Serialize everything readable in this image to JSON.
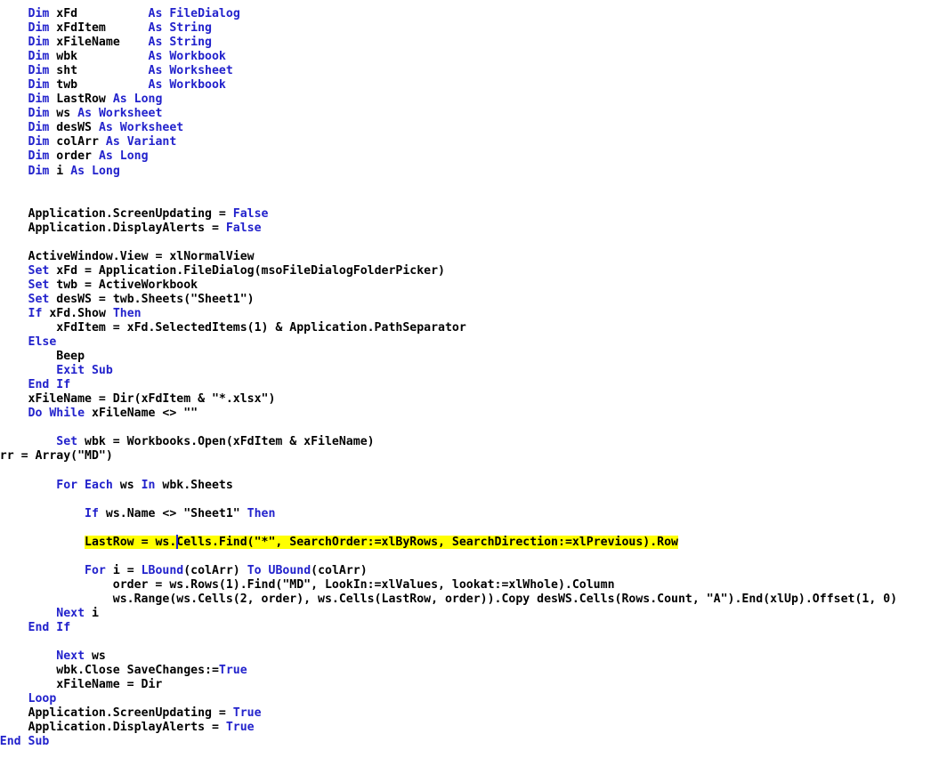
{
  "app": {
    "kind": "vba-code-editor",
    "language": "VBA",
    "colors": {
      "background": "#ffffff",
      "text": "#000000",
      "keyword": "#2222cc",
      "highlight": "#ffff00",
      "caret": "#2222cc"
    }
  },
  "editor": {
    "caret_after_text": "ws.",
    "highlighted_line_index": 37,
    "lines": [
      {
        "indent": 8,
        "tokens": [
          {
            "t": "kw",
            "v": "Dim"
          },
          {
            "t": "txt",
            "v": " xFd          "
          },
          {
            "t": "kw",
            "v": "As"
          },
          {
            "t": "txt",
            "v": " "
          },
          {
            "t": "kw",
            "v": "FileDialog"
          }
        ]
      },
      {
        "indent": 8,
        "tokens": [
          {
            "t": "kw",
            "v": "Dim"
          },
          {
            "t": "txt",
            "v": " xFdItem      "
          },
          {
            "t": "kw",
            "v": "As"
          },
          {
            "t": "txt",
            "v": " "
          },
          {
            "t": "kw",
            "v": "String"
          }
        ]
      },
      {
        "indent": 8,
        "tokens": [
          {
            "t": "kw",
            "v": "Dim"
          },
          {
            "t": "txt",
            "v": " xFileName    "
          },
          {
            "t": "kw",
            "v": "As"
          },
          {
            "t": "txt",
            "v": " "
          },
          {
            "t": "kw",
            "v": "String"
          }
        ]
      },
      {
        "indent": 8,
        "tokens": [
          {
            "t": "kw",
            "v": "Dim"
          },
          {
            "t": "txt",
            "v": " wbk          "
          },
          {
            "t": "kw",
            "v": "As"
          },
          {
            "t": "txt",
            "v": " "
          },
          {
            "t": "kw",
            "v": "Workbook"
          }
        ]
      },
      {
        "indent": 8,
        "tokens": [
          {
            "t": "kw",
            "v": "Dim"
          },
          {
            "t": "txt",
            "v": " sht          "
          },
          {
            "t": "kw",
            "v": "As"
          },
          {
            "t": "txt",
            "v": " "
          },
          {
            "t": "kw",
            "v": "Worksheet"
          }
        ]
      },
      {
        "indent": 8,
        "tokens": [
          {
            "t": "kw",
            "v": "Dim"
          },
          {
            "t": "txt",
            "v": " twb          "
          },
          {
            "t": "kw",
            "v": "As"
          },
          {
            "t": "txt",
            "v": " "
          },
          {
            "t": "kw",
            "v": "Workbook"
          }
        ]
      },
      {
        "indent": 8,
        "tokens": [
          {
            "t": "kw",
            "v": "Dim"
          },
          {
            "t": "txt",
            "v": " LastRow "
          },
          {
            "t": "kw",
            "v": "As"
          },
          {
            "t": "txt",
            "v": " "
          },
          {
            "t": "kw",
            "v": "Long"
          }
        ]
      },
      {
        "indent": 8,
        "tokens": [
          {
            "t": "kw",
            "v": "Dim"
          },
          {
            "t": "txt",
            "v": " ws "
          },
          {
            "t": "kw",
            "v": "As"
          },
          {
            "t": "txt",
            "v": " "
          },
          {
            "t": "kw",
            "v": "Worksheet"
          }
        ]
      },
      {
        "indent": 8,
        "tokens": [
          {
            "t": "kw",
            "v": "Dim"
          },
          {
            "t": "txt",
            "v": " desWS "
          },
          {
            "t": "kw",
            "v": "As"
          },
          {
            "t": "txt",
            "v": " "
          },
          {
            "t": "kw",
            "v": "Worksheet"
          }
        ]
      },
      {
        "indent": 8,
        "tokens": [
          {
            "t": "kw",
            "v": "Dim"
          },
          {
            "t": "txt",
            "v": " colArr "
          },
          {
            "t": "kw",
            "v": "As"
          },
          {
            "t": "txt",
            "v": " "
          },
          {
            "t": "kw",
            "v": "Variant"
          }
        ]
      },
      {
        "indent": 8,
        "tokens": [
          {
            "t": "kw",
            "v": "Dim"
          },
          {
            "t": "txt",
            "v": " order "
          },
          {
            "t": "kw",
            "v": "As"
          },
          {
            "t": "txt",
            "v": " "
          },
          {
            "t": "kw",
            "v": "Long"
          }
        ]
      },
      {
        "indent": 8,
        "tokens": [
          {
            "t": "kw",
            "v": "Dim"
          },
          {
            "t": "txt",
            "v": " i "
          },
          {
            "t": "kw",
            "v": "As"
          },
          {
            "t": "txt",
            "v": " "
          },
          {
            "t": "kw",
            "v": "Long"
          }
        ]
      },
      {
        "indent": 0,
        "tokens": []
      },
      {
        "indent": 0,
        "tokens": []
      },
      {
        "indent": 8,
        "tokens": [
          {
            "t": "txt",
            "v": "Application.ScreenUpdating = "
          },
          {
            "t": "kw",
            "v": "False"
          }
        ]
      },
      {
        "indent": 8,
        "tokens": [
          {
            "t": "txt",
            "v": "Application.DisplayAlerts = "
          },
          {
            "t": "kw",
            "v": "False"
          }
        ]
      },
      {
        "indent": 0,
        "tokens": []
      },
      {
        "indent": 8,
        "tokens": [
          {
            "t": "txt",
            "v": "ActiveWindow.View = xlNormalView"
          }
        ]
      },
      {
        "indent": 8,
        "tokens": [
          {
            "t": "kw",
            "v": "Set"
          },
          {
            "t": "txt",
            "v": " xFd = Application.FileDialog(msoFileDialogFolderPicker)"
          }
        ]
      },
      {
        "indent": 8,
        "tokens": [
          {
            "t": "kw",
            "v": "Set"
          },
          {
            "t": "txt",
            "v": " twb = ActiveWorkbook"
          }
        ]
      },
      {
        "indent": 8,
        "tokens": [
          {
            "t": "kw",
            "v": "Set"
          },
          {
            "t": "txt",
            "v": " desWS = twb.Sheets(\"Sheet1\")"
          }
        ]
      },
      {
        "indent": 8,
        "tokens": [
          {
            "t": "kw",
            "v": "If"
          },
          {
            "t": "txt",
            "v": " xFd.Show "
          },
          {
            "t": "kw",
            "v": "Then"
          }
        ]
      },
      {
        "indent": 12,
        "tokens": [
          {
            "t": "txt",
            "v": "xFdItem = xFd.SelectedItems(1) & Application.PathSeparator"
          }
        ]
      },
      {
        "indent": 8,
        "tokens": [
          {
            "t": "kw",
            "v": "Else"
          }
        ]
      },
      {
        "indent": 12,
        "tokens": [
          {
            "t": "txt",
            "v": "Beep"
          }
        ]
      },
      {
        "indent": 12,
        "tokens": [
          {
            "t": "kw",
            "v": "Exit Sub"
          }
        ]
      },
      {
        "indent": 8,
        "tokens": [
          {
            "t": "kw",
            "v": "End If"
          }
        ]
      },
      {
        "indent": 8,
        "tokens": [
          {
            "t": "txt",
            "v": "xFileName = Dir(xFdItem & \"*.xlsx\")"
          }
        ]
      },
      {
        "indent": 8,
        "tokens": [
          {
            "t": "kw",
            "v": "Do While"
          },
          {
            "t": "txt",
            "v": " xFileName <> \"\""
          }
        ]
      },
      {
        "indent": 0,
        "tokens": []
      },
      {
        "indent": 12,
        "tokens": [
          {
            "t": "kw",
            "v": "Set"
          },
          {
            "t": "txt",
            "v": " wbk = Workbooks.Open(xFdItem & xFileName)"
          }
        ]
      },
      {
        "indent": 0,
        "tokens": [
          {
            "t": "txt",
            "v": "colArr = Array(\"MD\")"
          }
        ]
      },
      {
        "indent": 0,
        "tokens": []
      },
      {
        "indent": 12,
        "tokens": [
          {
            "t": "kw",
            "v": "For Each"
          },
          {
            "t": "txt",
            "v": " ws "
          },
          {
            "t": "kw",
            "v": "In"
          },
          {
            "t": "txt",
            "v": " wbk.Sheets"
          }
        ]
      },
      {
        "indent": 0,
        "tokens": []
      },
      {
        "indent": 16,
        "tokens": [
          {
            "t": "kw",
            "v": "If"
          },
          {
            "t": "txt",
            "v": " ws.Name <> \"Sheet1\" "
          },
          {
            "t": "kw",
            "v": "Then"
          }
        ]
      },
      {
        "indent": 0,
        "tokens": []
      },
      {
        "indent": 16,
        "highlight": true,
        "tokens": [
          {
            "t": "txt",
            "v": "LastRow = ws."
          },
          {
            "t": "caret",
            "v": ""
          },
          {
            "t": "txt",
            "v": "Cells.Find(\"*\", SearchOrder:=xlByRows, SearchDirection:=xlPrevious).Row"
          }
        ]
      },
      {
        "indent": 0,
        "tokens": []
      },
      {
        "indent": 16,
        "tokens": [
          {
            "t": "kw",
            "v": "For"
          },
          {
            "t": "txt",
            "v": " i = "
          },
          {
            "t": "kw",
            "v": "LBound"
          },
          {
            "t": "txt",
            "v": "(colArr) "
          },
          {
            "t": "kw",
            "v": "To"
          },
          {
            "t": "txt",
            "v": " "
          },
          {
            "t": "kw",
            "v": "UBound"
          },
          {
            "t": "txt",
            "v": "(colArr)"
          }
        ]
      },
      {
        "indent": 20,
        "tokens": [
          {
            "t": "txt",
            "v": "order = ws.Rows(1).Find(\"MD\", LookIn:=xlValues, lookat:=xlWhole).Column"
          }
        ]
      },
      {
        "indent": 20,
        "tokens": [
          {
            "t": "txt",
            "v": "ws.Range(ws.Cells(2, order), ws.Cells(LastRow, order)).Copy desWS.Cells(Rows.Count, \"A\").End(xlUp).Offset(1, 0)"
          }
        ]
      },
      {
        "indent": 12,
        "tokens": [
          {
            "t": "kw",
            "v": "Next"
          },
          {
            "t": "txt",
            "v": " i"
          }
        ]
      },
      {
        "indent": 8,
        "tokens": [
          {
            "t": "kw",
            "v": "End If"
          }
        ]
      },
      {
        "indent": 0,
        "tokens": []
      },
      {
        "indent": 12,
        "tokens": [
          {
            "t": "kw",
            "v": "Next"
          },
          {
            "t": "txt",
            "v": " ws"
          }
        ]
      },
      {
        "indent": 12,
        "tokens": [
          {
            "t": "txt",
            "v": "wbk.Close SaveChanges:="
          },
          {
            "t": "kw",
            "v": "True"
          }
        ]
      },
      {
        "indent": 12,
        "tokens": [
          {
            "t": "txt",
            "v": "xFileName = Dir"
          }
        ]
      },
      {
        "indent": 8,
        "tokens": [
          {
            "t": "kw",
            "v": "Loop"
          }
        ]
      },
      {
        "indent": 8,
        "tokens": [
          {
            "t": "txt",
            "v": "Application.ScreenUpdating = "
          },
          {
            "t": "kw",
            "v": "True"
          }
        ]
      },
      {
        "indent": 8,
        "tokens": [
          {
            "t": "txt",
            "v": "Application.DisplayAlerts = "
          },
          {
            "t": "kw",
            "v": "True"
          }
        ]
      },
      {
        "indent": 4,
        "tokens": [
          {
            "t": "kw",
            "v": "End Sub"
          }
        ]
      }
    ]
  }
}
